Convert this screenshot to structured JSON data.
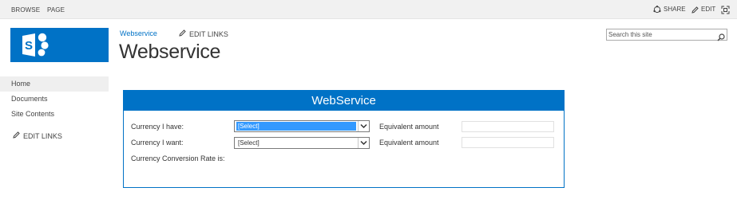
{
  "suitebar": {
    "tabs": [
      "BROWSE",
      "PAGE"
    ],
    "share_label": "SHARE",
    "edit_label": "EDIT"
  },
  "header": {
    "breadcrumb": "Webservice",
    "edit_links": "EDIT LINKS",
    "site_title": "Webservice"
  },
  "search": {
    "placeholder": "Search this site"
  },
  "leftnav": {
    "items": [
      "Home",
      "Documents",
      "Site Contents"
    ],
    "edit_links": "EDIT LINKS"
  },
  "webpart": {
    "title": "WebService",
    "currency_have_label": "Currency I have:",
    "currency_want_label": "Currency I want:",
    "rate_label": "Currency Conversion Rate is:",
    "equivalent_label": "Equivalent amount",
    "have_selected": "[Select]",
    "want_selected": "[Select]"
  },
  "colors": {
    "accent": "#0072c6",
    "selection": "#3399ff"
  },
  "icons": [
    "share-icon",
    "pencil-icon",
    "focus-icon",
    "sharepoint-logo",
    "magnifier-icon",
    "chevron-down-icon"
  ]
}
